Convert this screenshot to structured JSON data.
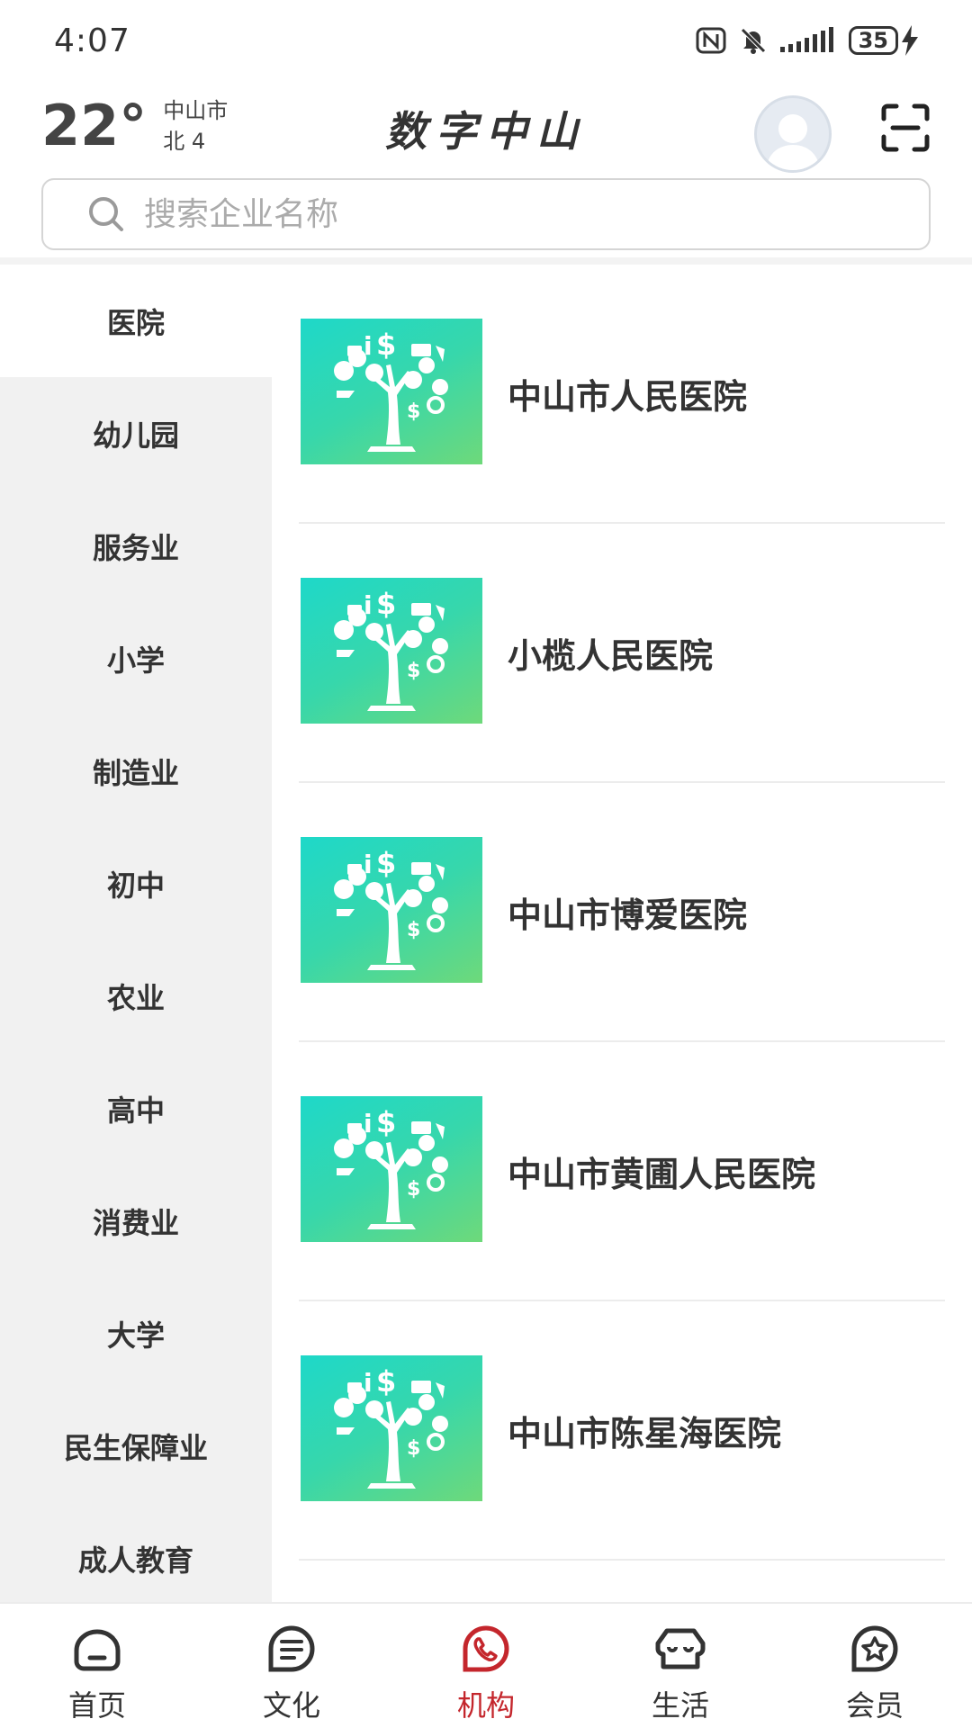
{
  "status_bar": {
    "time": "4:07",
    "battery": "35",
    "icons": [
      "nfc-icon",
      "mute-icon",
      "signal-icon",
      "battery-icon",
      "charging-icon"
    ]
  },
  "header": {
    "temperature": "22°",
    "city": "中山市",
    "wind": "北 4",
    "title": "数字中山",
    "avatar_icon": "avatar-icon",
    "scan_icon": "scan-icon"
  },
  "search": {
    "placeholder": "搜索企业名称",
    "icon": "search-icon"
  },
  "categories": [
    {
      "label": "医院",
      "active": true
    },
    {
      "label": "幼儿园"
    },
    {
      "label": "服务业"
    },
    {
      "label": "小学"
    },
    {
      "label": "制造业"
    },
    {
      "label": "初中"
    },
    {
      "label": "农业"
    },
    {
      "label": "高中"
    },
    {
      "label": "消费业"
    },
    {
      "label": "大学"
    },
    {
      "label": "民生保障业"
    },
    {
      "label": "成人教育"
    }
  ],
  "organizations": [
    {
      "name": "中山市人民医院",
      "thumb": "tree-logo-icon"
    },
    {
      "name": "小榄人民医院",
      "thumb": "tree-logo-icon"
    },
    {
      "name": "中山市博爱医院",
      "thumb": "tree-logo-icon"
    },
    {
      "name": "中山市黄圃人民医院",
      "thumb": "tree-logo-icon"
    },
    {
      "name": "中山市陈星海医院",
      "thumb": "tree-logo-icon"
    }
  ],
  "bottom_nav": [
    {
      "label": "首页",
      "icon": "home-icon"
    },
    {
      "label": "文化",
      "icon": "culture-icon"
    },
    {
      "label": "机构",
      "icon": "phone-icon",
      "active": true
    },
    {
      "label": "生活",
      "icon": "life-icon"
    },
    {
      "label": "会员",
      "icon": "member-icon"
    }
  ],
  "colors": {
    "accent": "#c4262c",
    "sidebar_bg": "#f1f1f1",
    "thumb_gradient_start": "#1ed8c9",
    "thumb_gradient_end": "#6ed97a"
  }
}
